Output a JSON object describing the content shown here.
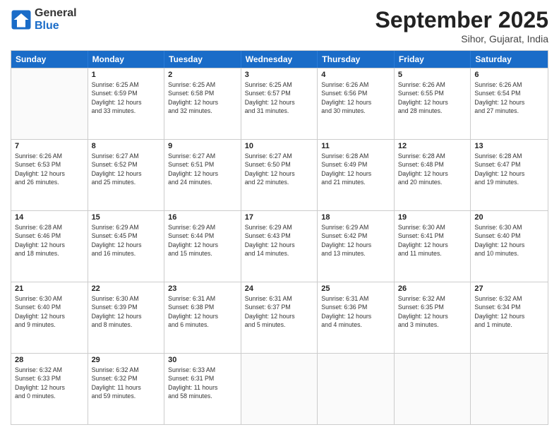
{
  "header": {
    "logo_line1": "General",
    "logo_line2": "Blue",
    "month": "September 2025",
    "location": "Sihor, Gujarat, India"
  },
  "weekdays": [
    "Sunday",
    "Monday",
    "Tuesday",
    "Wednesday",
    "Thursday",
    "Friday",
    "Saturday"
  ],
  "weeks": [
    [
      {
        "day": "",
        "info": ""
      },
      {
        "day": "1",
        "info": "Sunrise: 6:25 AM\nSunset: 6:59 PM\nDaylight: 12 hours\nand 33 minutes."
      },
      {
        "day": "2",
        "info": "Sunrise: 6:25 AM\nSunset: 6:58 PM\nDaylight: 12 hours\nand 32 minutes."
      },
      {
        "day": "3",
        "info": "Sunrise: 6:25 AM\nSunset: 6:57 PM\nDaylight: 12 hours\nand 31 minutes."
      },
      {
        "day": "4",
        "info": "Sunrise: 6:26 AM\nSunset: 6:56 PM\nDaylight: 12 hours\nand 30 minutes."
      },
      {
        "day": "5",
        "info": "Sunrise: 6:26 AM\nSunset: 6:55 PM\nDaylight: 12 hours\nand 28 minutes."
      },
      {
        "day": "6",
        "info": "Sunrise: 6:26 AM\nSunset: 6:54 PM\nDaylight: 12 hours\nand 27 minutes."
      }
    ],
    [
      {
        "day": "7",
        "info": "Sunrise: 6:26 AM\nSunset: 6:53 PM\nDaylight: 12 hours\nand 26 minutes."
      },
      {
        "day": "8",
        "info": "Sunrise: 6:27 AM\nSunset: 6:52 PM\nDaylight: 12 hours\nand 25 minutes."
      },
      {
        "day": "9",
        "info": "Sunrise: 6:27 AM\nSunset: 6:51 PM\nDaylight: 12 hours\nand 24 minutes."
      },
      {
        "day": "10",
        "info": "Sunrise: 6:27 AM\nSunset: 6:50 PM\nDaylight: 12 hours\nand 22 minutes."
      },
      {
        "day": "11",
        "info": "Sunrise: 6:28 AM\nSunset: 6:49 PM\nDaylight: 12 hours\nand 21 minutes."
      },
      {
        "day": "12",
        "info": "Sunrise: 6:28 AM\nSunset: 6:48 PM\nDaylight: 12 hours\nand 20 minutes."
      },
      {
        "day": "13",
        "info": "Sunrise: 6:28 AM\nSunset: 6:47 PM\nDaylight: 12 hours\nand 19 minutes."
      }
    ],
    [
      {
        "day": "14",
        "info": "Sunrise: 6:28 AM\nSunset: 6:46 PM\nDaylight: 12 hours\nand 18 minutes."
      },
      {
        "day": "15",
        "info": "Sunrise: 6:29 AM\nSunset: 6:45 PM\nDaylight: 12 hours\nand 16 minutes."
      },
      {
        "day": "16",
        "info": "Sunrise: 6:29 AM\nSunset: 6:44 PM\nDaylight: 12 hours\nand 15 minutes."
      },
      {
        "day": "17",
        "info": "Sunrise: 6:29 AM\nSunset: 6:43 PM\nDaylight: 12 hours\nand 14 minutes."
      },
      {
        "day": "18",
        "info": "Sunrise: 6:29 AM\nSunset: 6:42 PM\nDaylight: 12 hours\nand 13 minutes."
      },
      {
        "day": "19",
        "info": "Sunrise: 6:30 AM\nSunset: 6:41 PM\nDaylight: 12 hours\nand 11 minutes."
      },
      {
        "day": "20",
        "info": "Sunrise: 6:30 AM\nSunset: 6:40 PM\nDaylight: 12 hours\nand 10 minutes."
      }
    ],
    [
      {
        "day": "21",
        "info": "Sunrise: 6:30 AM\nSunset: 6:40 PM\nDaylight: 12 hours\nand 9 minutes."
      },
      {
        "day": "22",
        "info": "Sunrise: 6:30 AM\nSunset: 6:39 PM\nDaylight: 12 hours\nand 8 minutes."
      },
      {
        "day": "23",
        "info": "Sunrise: 6:31 AM\nSunset: 6:38 PM\nDaylight: 12 hours\nand 6 minutes."
      },
      {
        "day": "24",
        "info": "Sunrise: 6:31 AM\nSunset: 6:37 PM\nDaylight: 12 hours\nand 5 minutes."
      },
      {
        "day": "25",
        "info": "Sunrise: 6:31 AM\nSunset: 6:36 PM\nDaylight: 12 hours\nand 4 minutes."
      },
      {
        "day": "26",
        "info": "Sunrise: 6:32 AM\nSunset: 6:35 PM\nDaylight: 12 hours\nand 3 minutes."
      },
      {
        "day": "27",
        "info": "Sunrise: 6:32 AM\nSunset: 6:34 PM\nDaylight: 12 hours\nand 1 minute."
      }
    ],
    [
      {
        "day": "28",
        "info": "Sunrise: 6:32 AM\nSunset: 6:33 PM\nDaylight: 12 hours\nand 0 minutes."
      },
      {
        "day": "29",
        "info": "Sunrise: 6:32 AM\nSunset: 6:32 PM\nDaylight: 11 hours\nand 59 minutes."
      },
      {
        "day": "30",
        "info": "Sunrise: 6:33 AM\nSunset: 6:31 PM\nDaylight: 11 hours\nand 58 minutes."
      },
      {
        "day": "",
        "info": ""
      },
      {
        "day": "",
        "info": ""
      },
      {
        "day": "",
        "info": ""
      },
      {
        "day": "",
        "info": ""
      }
    ]
  ]
}
